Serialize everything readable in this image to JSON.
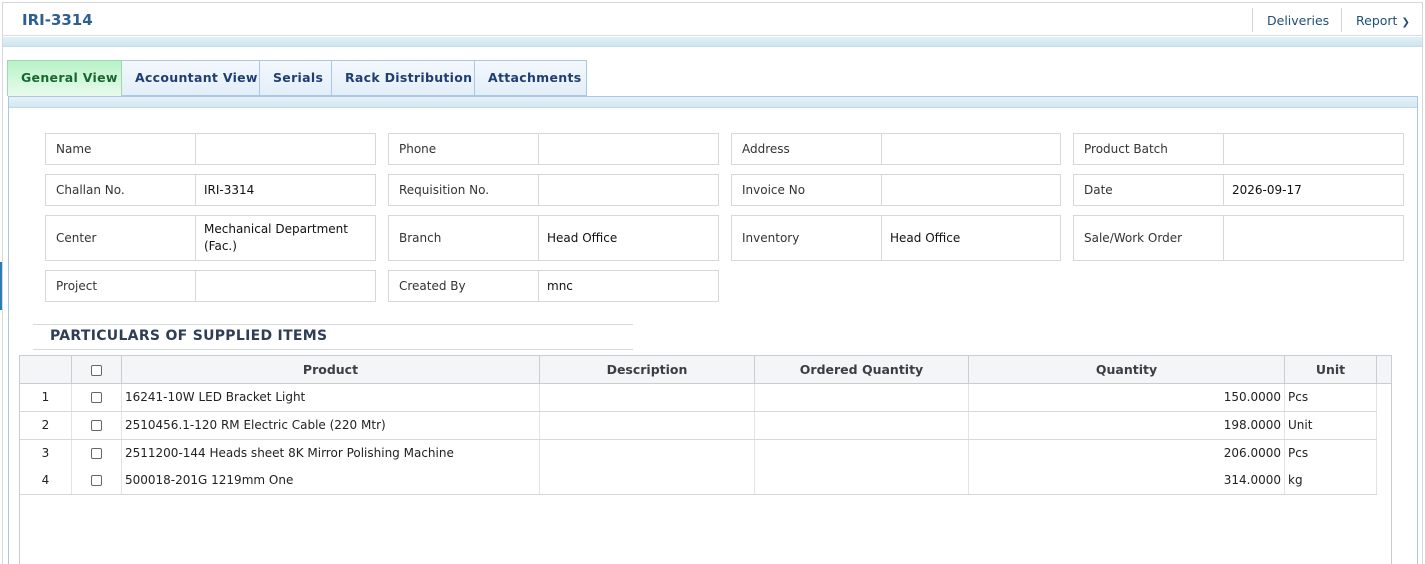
{
  "header": {
    "title": "IRI-3314",
    "links": {
      "deliveries": "Deliveries",
      "report": "Report"
    }
  },
  "tabs": [
    {
      "label": "General View",
      "active": true
    },
    {
      "label": "Accountant View",
      "active": false
    },
    {
      "label": "Serials",
      "active": false
    },
    {
      "label": "Rack Distribution",
      "active": false
    },
    {
      "label": "Attachments",
      "active": false
    }
  ],
  "fields": {
    "name": {
      "label": "Name",
      "value": ""
    },
    "phone": {
      "label": "Phone",
      "value": ""
    },
    "address": {
      "label": "Address",
      "value": ""
    },
    "product_batch": {
      "label": "Product Batch",
      "value": ""
    },
    "challan_no": {
      "label": "Challan No.",
      "value": "IRI-3314"
    },
    "requisition_no": {
      "label": "Requisition No.",
      "value": ""
    },
    "invoice_no": {
      "label": "Invoice No",
      "value": ""
    },
    "date": {
      "label": "Date",
      "value": "2026-09-17"
    },
    "center": {
      "label": "Center",
      "value": "Mechanical Department (Fac.)"
    },
    "branch": {
      "label": "Branch",
      "value": "Head Office"
    },
    "inventory": {
      "label": "Inventory",
      "value": "Head Office"
    },
    "sale_work_order": {
      "label": "Sale/Work Order",
      "value": ""
    },
    "project": {
      "label": "Project",
      "value": ""
    },
    "created_by": {
      "label": "Created By",
      "value": "mnc"
    }
  },
  "items_section": {
    "title": "PARTICULARS OF SUPPLIED ITEMS",
    "columns": [
      "Product",
      "Description",
      "Ordered Quantity",
      "Quantity",
      "Unit"
    ],
    "rows": [
      {
        "no": "1",
        "product": "16241-10W LED Bracket Light",
        "description": "",
        "ordered_quantity": "",
        "quantity": "150.0000",
        "unit": "Pcs"
      },
      {
        "no": "2",
        "product": "2510456.1-120 RM Electric Cable (220 Mtr)",
        "description": "",
        "ordered_quantity": "",
        "quantity": "198.0000",
        "unit": "Unit"
      },
      {
        "no": "3",
        "product": "2511200-144 Heads sheet 8K Mirror Polishing Machine",
        "description": "",
        "ordered_quantity": "",
        "quantity": "206.0000",
        "unit": "Pcs"
      },
      {
        "no": "4",
        "product": "500018-201G 1219mm One",
        "description": "",
        "ordered_quantity": "",
        "quantity": "314.0000",
        "unit": "kg"
      }
    ]
  }
}
